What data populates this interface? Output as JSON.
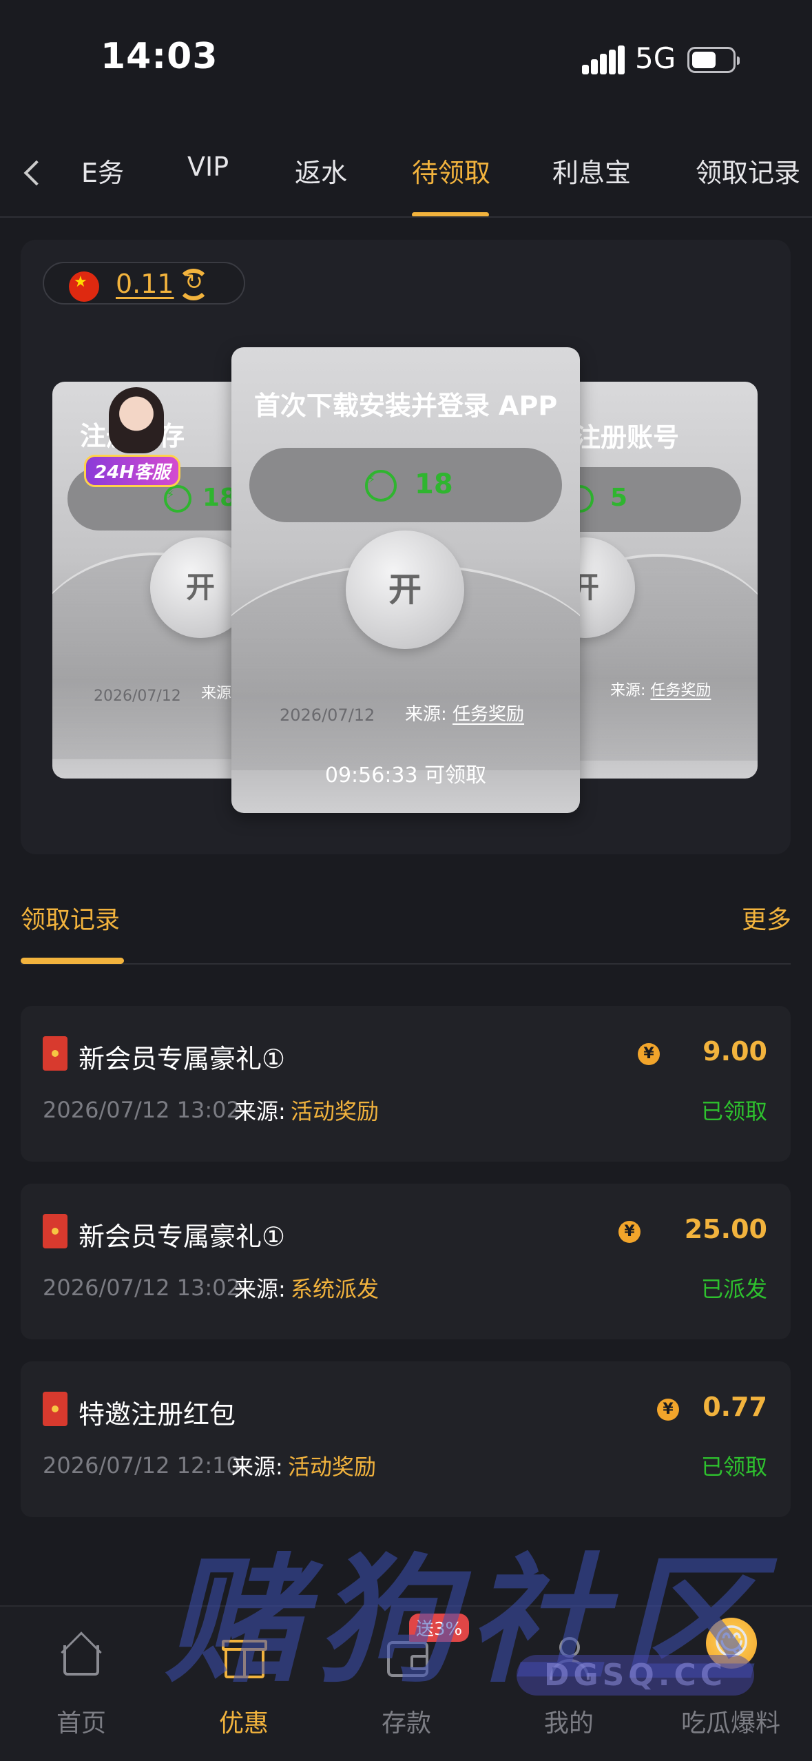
{
  "status_bar": {
    "time": "14:03",
    "network": "5G"
  },
  "tabs": [
    {
      "label": "E务"
    },
    {
      "label": "VIP"
    },
    {
      "label": "返水"
    },
    {
      "label": "待领取"
    },
    {
      "label": "利息宝"
    },
    {
      "label": "领取记录"
    }
  ],
  "active_tab": "待领取",
  "balance": {
    "value": "0.11"
  },
  "cards": {
    "left": {
      "title": "注册首存",
      "amount": "18",
      "button": "开",
      "date": "2026/07/12",
      "source_label": "来源"
    },
    "center": {
      "title": "首次下载安装并登录 APP",
      "amount": "18",
      "button": "开",
      "date": "2026/07/12",
      "source_label": "来源:",
      "source_value": "任务奖励",
      "countdown": "09:56:33 可领取"
    },
    "right": {
      "title": "注册账号",
      "amount": "5",
      "button": "开",
      "source_label": "来源:",
      "source_value": "任务奖励"
    }
  },
  "customer_service": {
    "label": "24H客服"
  },
  "records": {
    "title": "领取记录",
    "more": "更多",
    "items": [
      {
        "name": "新会员专属豪礼①",
        "amount": "9.00",
        "date": "2026/07/12 13:02",
        "source_label": "来源:",
        "source_value": "活动奖励",
        "status": "已领取"
      },
      {
        "name": "新会员专属豪礼①",
        "amount": "25.00",
        "date": "2026/07/12 13:02",
        "source_label": "来源:",
        "source_value": "系统派发",
        "status": "已派发"
      },
      {
        "name": "特邀注册红包",
        "amount": "0.77",
        "date": "2026/07/12 12:10",
        "source_label": "来源:",
        "source_value": "活动奖励",
        "status": "已领取"
      }
    ]
  },
  "watermark": {
    "text": "赌狗社区",
    "domain": "DGSQ.CC"
  },
  "bottom_nav": [
    {
      "label": "首页"
    },
    {
      "label": "优惠"
    },
    {
      "label": "存款"
    },
    {
      "label": "我的"
    },
    {
      "label": "吃瓜爆料"
    }
  ],
  "deposit_badge": "送3%",
  "colors": {
    "accent": "#f2b33d",
    "green": "#2ec12e",
    "bg": "#1a1b20",
    "card": "#212227"
  }
}
